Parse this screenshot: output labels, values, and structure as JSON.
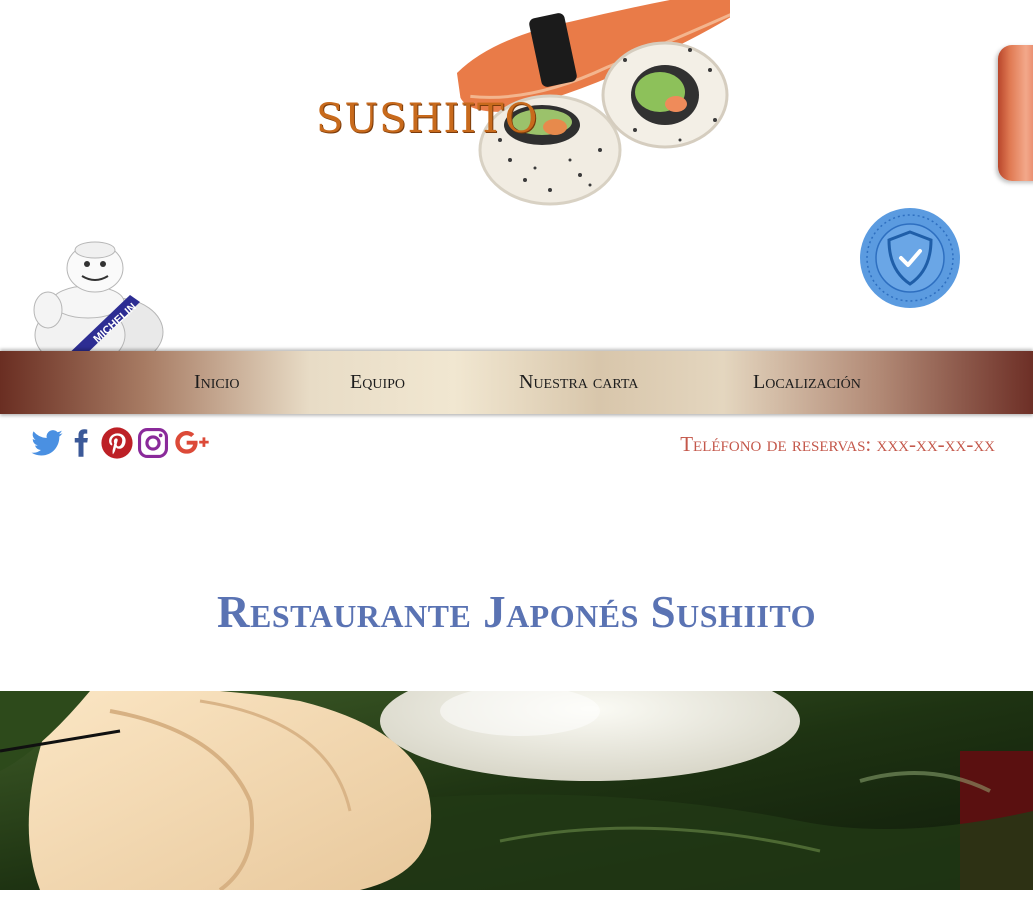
{
  "brand": {
    "logo_text": "SUSHIITO",
    "colors": {
      "logo": "#c86a1c",
      "title": "#5a73b3",
      "phone": "#c4584b",
      "nav_text": "#1d1d1d"
    }
  },
  "nav": {
    "items": [
      {
        "label": "Inicio"
      },
      {
        "label": "Equipo"
      },
      {
        "label": "Nuestra carta"
      },
      {
        "label": "Localización"
      }
    ]
  },
  "social": {
    "icons": [
      "twitter-icon",
      "facebook-icon",
      "pinterest-icon",
      "instagram-icon",
      "google-plus-icon"
    ]
  },
  "contact": {
    "phone_text": "Teléfono de reservas: xxx-xx-xx-xx"
  },
  "main": {
    "title": "Restaurante Japonés Sushiito"
  }
}
